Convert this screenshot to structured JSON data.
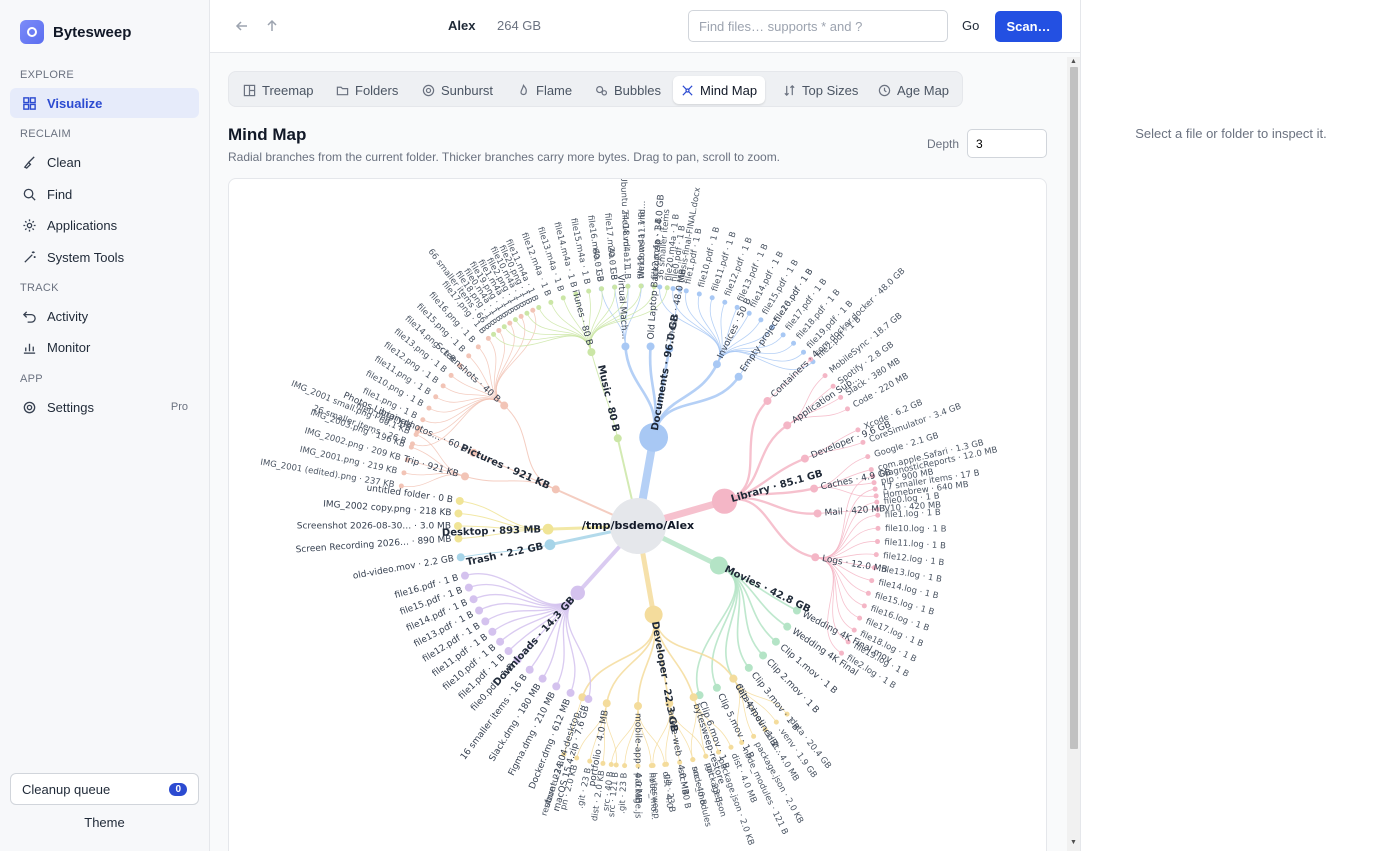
{
  "app": {
    "name": "Bytesweep"
  },
  "sidebar": {
    "sections": [
      {
        "label": "EXPLORE"
      },
      {
        "label": "RECLAIM"
      },
      {
        "label": "TRACK"
      },
      {
        "label": "APP"
      }
    ],
    "items": [
      {
        "label": "Visualize",
        "icon": "grid-icon"
      },
      {
        "label": "Clean",
        "icon": "broom-icon"
      },
      {
        "label": "Find",
        "icon": "search-icon"
      },
      {
        "label": "Applications",
        "icon": "gear-icon"
      },
      {
        "label": "System Tools",
        "icon": "wand-icon"
      },
      {
        "label": "Activity",
        "icon": "undo-icon"
      },
      {
        "label": "Monitor",
        "icon": "bar-chart-icon"
      },
      {
        "label": "Settings",
        "icon": "gear-icon",
        "badge": "Pro"
      }
    ],
    "cleanup_label": "Cleanup queue",
    "cleanup_count": "0",
    "theme_label": "Theme"
  },
  "topbar": {
    "user": "Alex",
    "size": "264 GB",
    "search_placeholder": "Find files… supports * and ?",
    "go_label": "Go",
    "scan_label": "Scan…"
  },
  "tabs": [
    {
      "label": "Treemap"
    },
    {
      "label": "Folders"
    },
    {
      "label": "Sunburst"
    },
    {
      "label": "Flame"
    },
    {
      "label": "Bubbles"
    },
    {
      "label": "Mind Map",
      "active": true
    },
    {
      "label": "Top Sizes"
    },
    {
      "label": "Age Map"
    }
  ],
  "view": {
    "title": "Mind Map",
    "subtitle": "Radial branches from the current folder. Thicker branches carry more bytes. Drag to pan, scroll to zoom.",
    "depth_label": "Depth",
    "depth_value": "3"
  },
  "inspector": {
    "empty_text": "Select a file or folder to inspect it."
  },
  "colors": {
    "accent": "#2350e2",
    "documents": "#a8c8f4",
    "library": "#f4b6c6",
    "movies": "#b4e4c6",
    "developer": "#f4dc9c",
    "downloads": "#d4c2ee",
    "trash": "#a6d4e8",
    "desktop": "#f0e496",
    "pictures": "#f2c4b6",
    "music": "#cbe6a6"
  },
  "mindmap": {
    "root": "/tmp/bsdemo/Alex",
    "branches": [
      {
        "label": "Documents · 96.0 GB",
        "color": "#a8c8f4",
        "angle": -80,
        "weight": 8,
        "children": [
          {
            "label": "Virtual Mach…",
            "angle": -94,
            "leaves": [
              "60.0 GB",
              "20.0 GB",
              "Ubuntu 24.04.vdi · 11.…",
              "Windows 11.vhd…"
            ]
          },
          {
            "label": "Old Laptop Backup.zip · 34.0 GB",
            "angle": -86,
            "leaves": []
          },
          {
            "label": "Thesis · 48.0 MB",
            "angle": -80,
            "leaves": [
              "thesis-final-FINAL.docx"
            ]
          },
          {
            "label": "Invoices · 50 B",
            "angle": -64,
            "leaves": [
              "36 smaller items",
              "file0.pdf · 1 B",
              "file1.pdf · 1 B",
              "file10.pdf · 1 B",
              "file11.pdf · 1 B",
              "file12.pdf · 1 B",
              "file13.pdf · 1 B",
              "file14.pdf · 1 B",
              "file15.pdf · 1 B",
              "file16.pdf · 1 B",
              "file17.pdf · 1 B",
              "file18.pdf · 1 B",
              "file19.pdf · 1 B",
              "file2.pdf · 1 B"
            ]
          },
          {
            "label": "Empty project",
            "angle": -56,
            "leaves": [
              "file20.pdf · 1 B"
            ]
          }
        ]
      },
      {
        "label": "Library · 85.1 GB",
        "color": "#f4b6c6",
        "angle": -16,
        "weight": 7,
        "children": [
          {
            "label": "Containers · 4…",
            "angle": -44,
            "leaves": [
              "com.docker.docker · 48.0 GB"
            ]
          },
          {
            "label": "Application Sup…",
            "angle": -34,
            "leaves": [
              "MobileSync · 18.7 GB",
              "Spotify · 2.8 GB",
              "Slack · 380 MB",
              "Code · 220 MB"
            ]
          },
          {
            "label": "Developer · 9.6 GB",
            "angle": -22,
            "leaves": [
              "Xcode · 6.2 GB",
              "CoreSimulator · 3.4 GB"
            ]
          },
          {
            "label": "Caches · 4.9 GB",
            "angle": -12,
            "leaves": [
              "Google · 2.1 GB",
              "com.apple.Safari · 1.3 GB",
              "pip · 900 MB",
              "Homebrew · 640 MB"
            ]
          },
          {
            "label": "Mail · 420 MB",
            "angle": -4,
            "leaves": [
              "V10 · 420 MB"
            ]
          },
          {
            "label": "Logs · 12.0 MB",
            "angle": 10,
            "leaves": [
              "DiagnosticReports · 12.0 MB",
              "17 smaller items · 17 B",
              "file0.log · 1 B",
              "file1.log · 1 B",
              "file10.log · 1 B",
              "file11.log · 1 B",
              "file12.log · 1 B",
              "file13.log · 1 B",
              "file14.log · 1 B",
              "file15.log · 1 B",
              "file16.log · 1 B",
              "file17.log · 1 B",
              "file18.log · 1 B",
              "file19.log · 1 B",
              "file2.log · 1 B"
            ]
          }
        ]
      },
      {
        "label": "Movies · 42.8 GB",
        "color": "#b4e4c6",
        "angle": 26,
        "weight": 5,
        "children": [
          {
            "label": "Wedding 4K Final.mov",
            "angle": 28,
            "leaves": []
          },
          {
            "label": "Wedding 4K Final",
            "angle": 34,
            "leaves": []
          },
          {
            "label": "Clip 1.mov · 1 B",
            "angle": 40,
            "leaves": []
          },
          {
            "label": "Clip 2.mov · 1 B",
            "angle": 46,
            "leaves": []
          },
          {
            "label": "Clip 3.mov · 1 B",
            "angle": 52,
            "leaves": []
          },
          {
            "label": "Clip 4.mov · 1 B",
            "angle": 58,
            "leaves": []
          },
          {
            "label": "Clip 5.mov · 1 B",
            "angle": 64,
            "leaves": []
          },
          {
            "label": "Clip 6.mov · 1 B",
            "angle": 70,
            "leaves": []
          }
        ]
      },
      {
        "label": "Developer · 22.3 GB",
        "color": "#f4dc9c",
        "angle": 80,
        "weight": 5,
        "children": [
          {
            "label": "data-pipeline · 2…",
            "angle": 58,
            "leaves": [
              "data · 20.4 GB",
              ".venv · 1.9 GB",
              "dist · 4.0 MB",
              "package.json · 2.0 KB",
              "node_modules · 121 B"
            ]
          },
          {
            "label": "bytesweep-restore",
            "angle": 72,
            "leaves": [
              "dist · 4.0 MB",
              "package.json · 2.0 KB",
              ".git · 23 B",
              "src · 40 B"
            ]
          },
          {
            "label": "acme-web · 4.0 MB",
            "angle": 80,
            "leaves": [
              "package.json",
              "node_modules",
              "src · 40 B",
              ".git · 23 B",
              "bytesweep"
            ]
          },
          {
            "label": "mobile-app · 4.0 MB",
            "angle": 90,
            "leaves": [
              "dist · 4.0",
              "node_mo…",
              "package.js",
              ".git · 23 B",
              "src · 40 B"
            ]
          },
          {
            "label": "portfolio · 4.0 MB",
            "angle": 100,
            "leaves": [
              "src · 121 B",
              "dist · 2.0 KB",
              ".git · 23 B",
              "pn · 2.0 KB"
            ]
          },
          {
            "label": "ubuntu-24.04-desktop…",
            "angle": 108,
            "leaves": [
              "restore · 23 B"
            ]
          }
        ]
      },
      {
        "label": "Downloads · 14.3 GB",
        "color": "#d4c2ee",
        "angle": 132,
        "weight": 4,
        "children": [
          {
            "label": "macOS 15.4.zip · 7.6 GB",
            "angle": 106,
            "leaves": []
          },
          {
            "label": "Docker.dmg · 612 MB",
            "angle": 112,
            "leaves": []
          },
          {
            "label": "Figma.dmg · 210 MB",
            "angle": 117,
            "leaves": []
          },
          {
            "label": "Slack.dmg · 180 MB",
            "angle": 122,
            "leaves": []
          },
          {
            "label": "16 smaller items · 16 B",
            "angle": 127,
            "leaves": []
          },
          {
            "label": "file0.pdf · 1 B",
            "angle": 132,
            "leaves": []
          },
          {
            "label": "file1.pdf · 1 B",
            "angle": 136,
            "leaves": []
          },
          {
            "label": "file10.pdf · 1 B",
            "angle": 140,
            "leaves": []
          },
          {
            "label": "file11.pdf · 1 B",
            "angle": 144,
            "leaves": []
          },
          {
            "label": "file12.pdf · 1 B",
            "angle": 148,
            "leaves": []
          },
          {
            "label": "file13.pdf · 1 B",
            "angle": 152,
            "leaves": []
          },
          {
            "label": "file14.pdf · 1 B",
            "angle": 156,
            "leaves": []
          },
          {
            "label": "file15.pdf · 1 B",
            "angle": 160,
            "leaves": []
          },
          {
            "label": "file16.pdf · 1 B",
            "angle": 164,
            "leaves": []
          }
        ]
      },
      {
        "label": "Trash · 2.2 GB",
        "color": "#a6d4e8",
        "angle": 168,
        "weight": 3,
        "children": [
          {
            "label": "old-video.mov · 2.2 GB",
            "angle": 170,
            "leaves": []
          }
        ]
      },
      {
        "label": "Desktop · 893 MB",
        "color": "#f0e496",
        "angle": 178,
        "weight": 3,
        "children": [
          {
            "label": "Screen Recording 2026… · 890 MB",
            "angle": 176,
            "leaves": []
          },
          {
            "label": "Screenshot 2026-08-30… · 3.0 MB",
            "angle": 180,
            "leaves": []
          },
          {
            "label": "IMG_2002 copy.png · 218 KB",
            "angle": 184,
            "leaves": []
          },
          {
            "label": "untitled folder · 0 B",
            "angle": 188,
            "leaves": []
          }
        ]
      },
      {
        "label": "Pictures · 921 KB",
        "color": "#f2c4b6",
        "angle": 204,
        "weight": 2,
        "children": [
          {
            "label": "Trip · 921 KB",
            "angle": 196,
            "leaves": [
              "IMG_2001 (edited).png · 237 KB",
              "IMG_2001.png · 219 KB",
              "IMG_2002.png · 209 KB",
              "IMG_2003.png · 196 KB",
              "IMG_2001 small.png · 60.1 KB"
            ]
          },
          {
            "label": "Photos Library.photos… · 60 B",
            "angle": 204,
            "leaves": [
              "originals"
            ]
          },
          {
            "label": "Screenshots · 40 B",
            "angle": 222,
            "leaves": [
              "26 smaller items · 26 B",
              "file0.png · 1 B",
              "file1.png · 1 B",
              "file10.png · 1 B",
              "file11.png · 1 B",
              "file12.png · 1 B",
              "file13.png · 1 B",
              "file14.png · 1 B",
              "file15.png · 1 B",
              "file16.png · 1 B",
              "file17.png · 1 B",
              "file18.png · 1 B",
              "file19.png · 1 B",
              "file2.png · 1 B",
              "file20.png · 1 B"
            ]
          }
        ]
      },
      {
        "label": "Music · 80 B",
        "color": "#cbe6a6",
        "angle": 257,
        "weight": 2,
        "children": [
          {
            "label": "iTunes · 80 B",
            "angle": 255,
            "leaves": [
              "66 smaller items · 66 B",
              "file0.m4a · 1 B",
              "file1.m4a · 1 B",
              "file10.m4a · 1 B",
              "file11.m4a · 1 B",
              "file12.m4a · 1 B",
              "file13.m4a · 1 B",
              "file14.m4a · 1 B",
              "file15.m4a · 1 B",
              "file16.m4a · 1 B",
              "file17.m4a · 1 B",
              "file18.m4a · 1 B",
              "file19.m4a · 1 B",
              "file2.m4a · 1 B",
              "file20.m4a · 1 B"
            ]
          }
        ]
      }
    ]
  }
}
